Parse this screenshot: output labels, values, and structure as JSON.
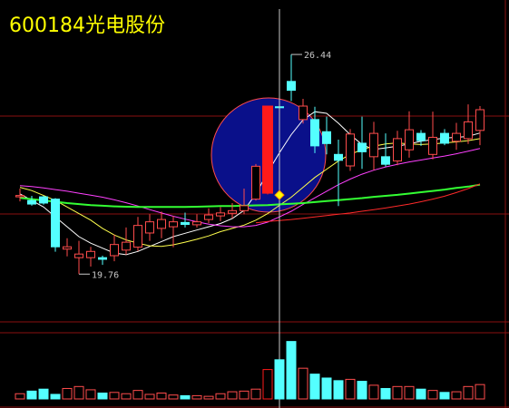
{
  "title": "600184光电股份",
  "colors": {
    "background": "#000000",
    "up": "#ff4c4c",
    "down": "#54ffff",
    "highlight_bar": "#ff1a1a",
    "highlight_circle": "#0a108a",
    "ma5": "#ffffff",
    "ma10": "#ffff4d",
    "ma20": "#ff40ff",
    "ma60": "#33ff33",
    "ma120": "#ff2a2a",
    "grid": "#8a1010",
    "annotation": "#c8c8c8",
    "cursor": "#c8c8c8",
    "title": "#ffff00"
  },
  "chart_data": [
    {
      "type": "candlestick",
      "title": "600184光电股份",
      "ylim": [
        18.5,
        27.6
      ],
      "annotations": [
        {
          "text": "26.44",
          "value": 26.44,
          "candle": 23
        },
        {
          "text": "19.76",
          "value": 19.76,
          "candle": 5
        }
      ],
      "highlight_candle": 21,
      "cursor_candle": 22,
      "candles": [
        {
          "o": 22.11,
          "h": 22.36,
          "l": 21.97,
          "c": 22.15
        },
        {
          "o": 22.0,
          "h": 22.14,
          "l": 21.84,
          "c": 21.89
        },
        {
          "o": 22.11,
          "h": 22.14,
          "l": 21.87,
          "c": 21.92
        },
        {
          "o": 22.04,
          "h": 22.07,
          "l": 20.44,
          "c": 20.59
        },
        {
          "o": 20.52,
          "h": 20.85,
          "l": 20.3,
          "c": 20.59
        },
        {
          "o": 20.26,
          "h": 20.77,
          "l": 19.76,
          "c": 20.37
        },
        {
          "o": 20.26,
          "h": 20.59,
          "l": 19.99,
          "c": 20.45
        },
        {
          "o": 20.26,
          "h": 20.32,
          "l": 20.04,
          "c": 20.21
        },
        {
          "o": 20.32,
          "h": 20.96,
          "l": 20.15,
          "c": 20.66
        },
        {
          "o": 20.49,
          "h": 21.18,
          "l": 20.35,
          "c": 20.73
        },
        {
          "o": 20.58,
          "h": 21.5,
          "l": 20.46,
          "c": 21.24
        },
        {
          "o": 21.01,
          "h": 21.58,
          "l": 20.77,
          "c": 21.35
        },
        {
          "o": 21.15,
          "h": 21.66,
          "l": 20.85,
          "c": 21.42
        },
        {
          "o": 21.2,
          "h": 21.53,
          "l": 20.58,
          "c": 21.35
        },
        {
          "o": 21.33,
          "h": 21.63,
          "l": 21.18,
          "c": 21.27
        },
        {
          "o": 21.26,
          "h": 21.58,
          "l": 21.18,
          "c": 21.35
        },
        {
          "o": 21.42,
          "h": 21.76,
          "l": 21.31,
          "c": 21.56
        },
        {
          "o": 21.53,
          "h": 21.8,
          "l": 21.37,
          "c": 21.62
        },
        {
          "o": 21.61,
          "h": 21.92,
          "l": 21.45,
          "c": 21.69
        },
        {
          "o": 21.69,
          "h": 22.36,
          "l": 21.58,
          "c": 21.84
        },
        {
          "o": 22.04,
          "h": 23.11,
          "l": 22.0,
          "c": 23.04
        },
        {
          "o": 22.22,
          "h": 24.87,
          "l": 22.18,
          "c": 24.87
        },
        {
          "o": 24.85,
          "h": 26.2,
          "l": 24.33,
          "c": 24.82
        },
        {
          "o": 25.62,
          "h": 26.44,
          "l": 25.02,
          "c": 25.35
        },
        {
          "o": 24.46,
          "h": 25.09,
          "l": 24.34,
          "c": 24.87
        },
        {
          "o": 24.46,
          "h": 24.85,
          "l": 23.44,
          "c": 23.66
        },
        {
          "o": 24.09,
          "h": 24.55,
          "l": 23.4,
          "c": 23.73
        },
        {
          "o": 23.4,
          "h": 23.85,
          "l": 21.83,
          "c": 23.22
        },
        {
          "o": 23.05,
          "h": 24.17,
          "l": 22.9,
          "c": 24.02
        },
        {
          "o": 23.74,
          "h": 24.55,
          "l": 22.96,
          "c": 23.48
        },
        {
          "o": 23.33,
          "h": 24.39,
          "l": 22.92,
          "c": 24.04
        },
        {
          "o": 23.33,
          "h": 24.04,
          "l": 23.03,
          "c": 23.1
        },
        {
          "o": 23.2,
          "h": 24.12,
          "l": 23.07,
          "c": 23.88
        },
        {
          "o": 23.54,
          "h": 24.71,
          "l": 23.3,
          "c": 24.15
        },
        {
          "o": 24.04,
          "h": 24.14,
          "l": 23.66,
          "c": 23.82
        },
        {
          "o": 23.4,
          "h": 24.7,
          "l": 23.25,
          "c": 23.92
        },
        {
          "o": 24.04,
          "h": 24.17,
          "l": 23.68,
          "c": 23.74
        },
        {
          "o": 23.8,
          "h": 24.36,
          "l": 23.54,
          "c": 24.04
        },
        {
          "o": 23.88,
          "h": 24.92,
          "l": 23.72,
          "c": 24.39
        },
        {
          "o": 24.13,
          "h": 24.87,
          "l": 23.68,
          "c": 24.76
        }
      ],
      "moving_averages": [
        {
          "name": "MA5",
          "colorKey": "ma5",
          "values": [
            22.2,
            22.0,
            21.8,
            21.5,
            21.2,
            20.9,
            20.7,
            20.55,
            20.4,
            20.35,
            20.45,
            20.6,
            20.75,
            20.9,
            21.0,
            21.1,
            21.2,
            21.3,
            21.45,
            21.7,
            22.2,
            22.85,
            23.45,
            24.0,
            24.45,
            24.7,
            24.65,
            24.35,
            24.0,
            23.7,
            23.55,
            23.6,
            23.65,
            23.72,
            23.8,
            23.85,
            23.9,
            23.92,
            23.95,
            24.05
          ]
        },
        {
          "name": "MA10",
          "colorKey": "ma10",
          "values": [
            22.4,
            22.3,
            22.15,
            22.0,
            21.8,
            21.6,
            21.4,
            21.15,
            20.95,
            20.8,
            20.7,
            20.62,
            20.6,
            20.65,
            20.73,
            20.82,
            20.92,
            21.05,
            21.15,
            21.25,
            21.4,
            21.6,
            21.85,
            22.1,
            22.4,
            22.7,
            22.95,
            23.2,
            23.4,
            23.55,
            23.65,
            23.72,
            23.75,
            23.72,
            23.7,
            23.72,
            23.75,
            23.78,
            23.82,
            23.88
          ]
        },
        {
          "name": "MA20",
          "colorKey": "ma20",
          "values": [
            22.45,
            22.42,
            22.38,
            22.33,
            22.28,
            22.22,
            22.16,
            22.1,
            22.02,
            21.93,
            21.83,
            21.72,
            21.62,
            21.52,
            21.43,
            21.35,
            21.28,
            21.23,
            21.2,
            21.2,
            21.24,
            21.34,
            21.5,
            21.67,
            21.88,
            22.08,
            22.28,
            22.48,
            22.65,
            22.8,
            22.92,
            23.02,
            23.1,
            23.17,
            23.23,
            23.29,
            23.35,
            23.42,
            23.5,
            23.58
          ]
        },
        {
          "name": "MA60",
          "colorKey": "ma60",
          "values": [
            22.08,
            22.04,
            22.0,
            21.96,
            21.92,
            21.89,
            21.86,
            21.84,
            21.82,
            21.81,
            21.8,
            21.8,
            21.8,
            21.8,
            21.8,
            21.81,
            21.82,
            21.83,
            21.83,
            21.84,
            21.85,
            21.86,
            21.88,
            21.9,
            21.92,
            21.95,
            21.98,
            22.01,
            22.04,
            22.07,
            22.11,
            22.14,
            22.17,
            22.21,
            22.25,
            22.29,
            22.33,
            22.38,
            22.42,
            22.48
          ]
        },
        {
          "name": "MA120",
          "colorKey": "ma120",
          "values": [
            null,
            null,
            null,
            null,
            null,
            null,
            null,
            null,
            null,
            null,
            null,
            null,
            null,
            null,
            null,
            null,
            null,
            null,
            null,
            null,
            21.32,
            21.36,
            21.39,
            21.42,
            21.46,
            21.5,
            21.54,
            21.58,
            21.62,
            21.67,
            21.72,
            21.77,
            21.83,
            21.89,
            21.96,
            22.04,
            22.13,
            22.24,
            22.36,
            22.5
          ]
        }
      ]
    },
    {
      "type": "bar",
      "title": "",
      "volume_max": 100,
      "values": [
        8,
        12,
        15,
        7,
        16,
        19,
        14,
        9,
        10,
        8,
        13,
        7,
        9,
        6,
        5,
        5,
        4,
        8,
        11,
        12,
        15,
        45,
        60,
        88,
        47,
        38,
        32,
        28,
        30,
        27,
        21,
        16,
        19,
        19,
        15,
        13,
        10,
        11,
        19,
        22
      ]
    }
  ]
}
